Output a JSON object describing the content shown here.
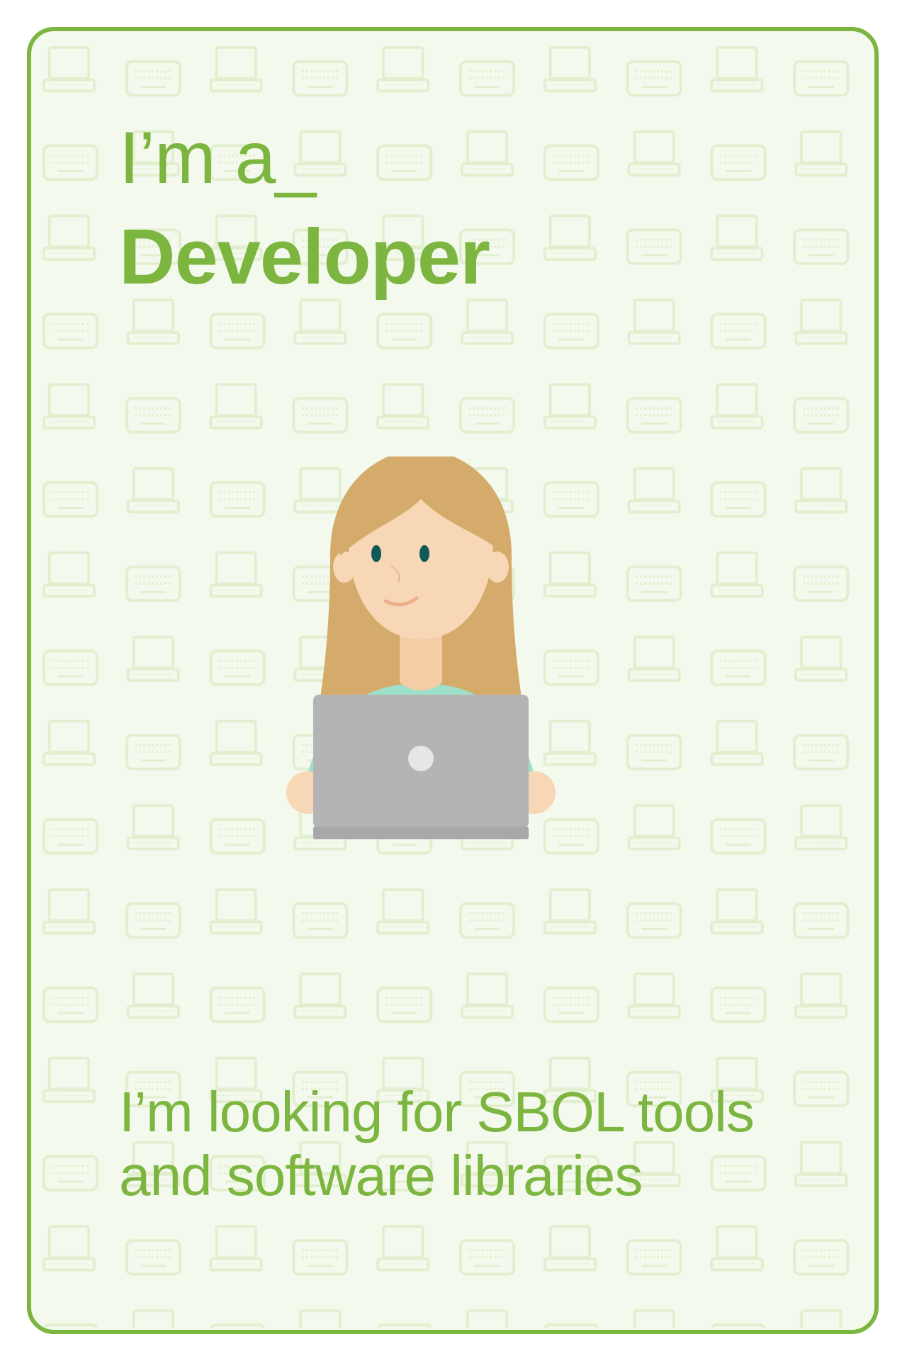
{
  "card": {
    "title_prefix": "I’m a_",
    "role": "Developer",
    "description": "I’m looking for SBOL tools and software libraries"
  },
  "pattern": {
    "icons": [
      "laptop-icon",
      "keyboard-icon"
    ]
  },
  "illustration": {
    "subject": "developer-with-laptop"
  },
  "colors": {
    "accent": "#7cb53f",
    "card_background": "#f4f9ee",
    "pattern": "#e2efcf",
    "hair": "#d4ab6a",
    "skin": "#f7d7b6",
    "shirt": "#9ddfc9",
    "laptop": "#b4b4b7",
    "eyes": "#0f5a57"
  }
}
